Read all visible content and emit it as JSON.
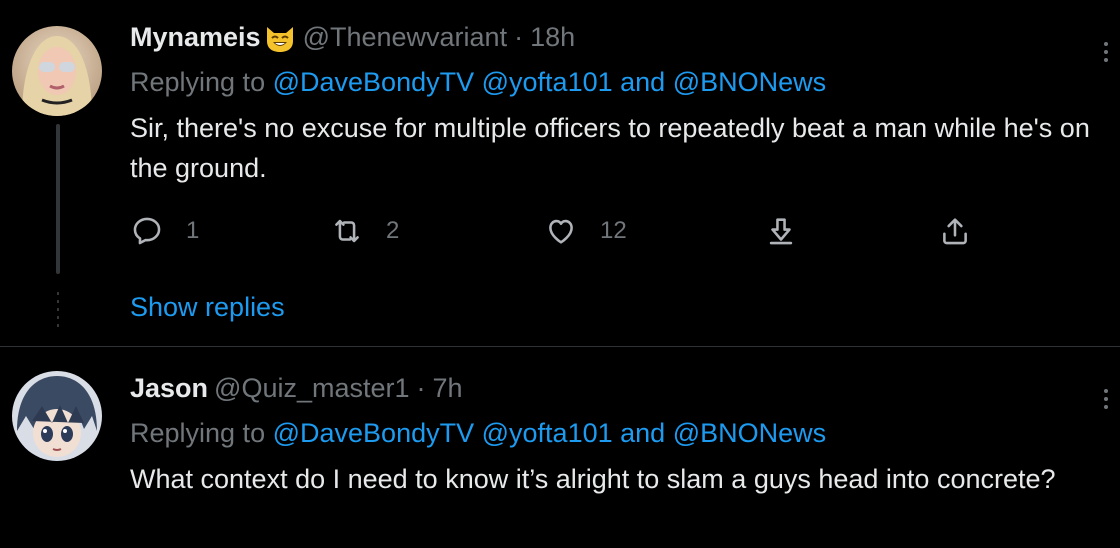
{
  "tweets": [
    {
      "name": "Mynameis",
      "handle": "@Thenewvariant",
      "separator": "·",
      "time": "18h",
      "replying_prefix": "Replying to",
      "mention1": "@DaveBondyTV",
      "mention2": "@yofta101",
      "and": "and",
      "mention3": "@BNONews",
      "text": "Sir, there's no excuse for multiple officers to repeatedly beat a man while he's on the ground.",
      "actions": {
        "reply_count": "1",
        "retweet_count": "2",
        "like_count": "12"
      },
      "show_replies": "Show replies",
      "avatar_icon": "avatar-blonde-sunglasses",
      "emoji_icon": "smiling-cat-emoji-icon"
    },
    {
      "name": "Jason",
      "handle": "@Quiz_master1",
      "separator": "·",
      "time": "7h",
      "replying_prefix": "Replying to",
      "mention1": "@DaveBondyTV",
      "mention2": "@yofta101",
      "and": "and",
      "mention3": "@BNONews",
      "text": "What context do I need to know it’s alright to slam a guys head into concrete?",
      "avatar_icon": "avatar-anime-character"
    }
  ],
  "colors": {
    "background": "#000000",
    "text": "#e7e9ea",
    "secondary": "#71767b",
    "link": "#1d9bf0",
    "divider": "#2f3336"
  }
}
